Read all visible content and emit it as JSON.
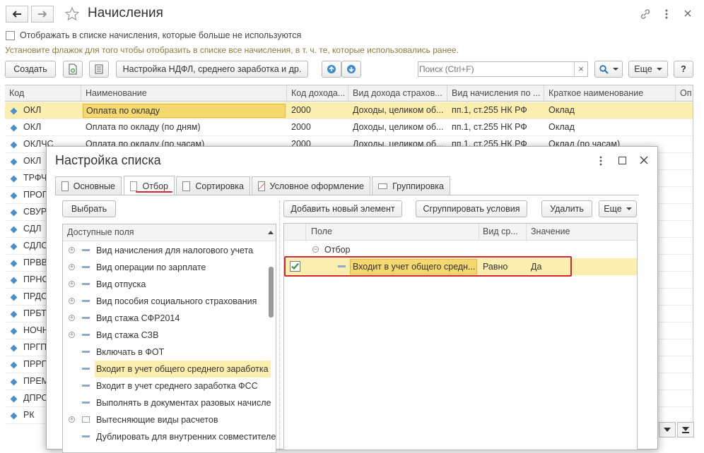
{
  "window": {
    "title": "Начисления",
    "checkbox_label": "Отображать в списке начисления, которые больше не используются",
    "hint": "Установите флажок для того чтобы отобразить в списке все начисления, в т. ч. те, которые использовались ранее."
  },
  "toolbar": {
    "create_label": "Создать",
    "ndfl_label": "Настройка НДФЛ, среднего заработка и др.",
    "search_placeholder": "Поиск (Ctrl+F)",
    "search_clear": "×",
    "more_label": "Еще",
    "help_label": "?"
  },
  "grid": {
    "columns": [
      "Код",
      "Наименование",
      "Код дохода...",
      "Вид дохода страхов...",
      "Вид начисления по ...",
      "Краткое наименование",
      "Оп"
    ],
    "rows": [
      [
        "ОКЛ",
        "Оплата по окладу",
        "2000",
        "Доходы, целиком об...",
        "пп.1, ст.255 НК РФ",
        "Оклад"
      ],
      [
        "ОКЛ",
        "Оплата по окладу (по дням)",
        "2000",
        "Доходы, целиком об...",
        "пп.1, ст.255 НК РФ",
        "Оклад"
      ],
      [
        "ОКЛЧС",
        "Оплата по окладу (по часам)",
        "2000",
        "Доходы, целиком об...",
        "пп.1, ст.255 НК РФ",
        "Оклад (по часам)"
      ],
      [
        "ОКЛ",
        "",
        "",
        "",
        "",
        ""
      ],
      [
        "ТРФЧ",
        "",
        "",
        "",
        "",
        ""
      ],
      [
        "ПРОГ",
        "",
        "",
        "",
        "",
        ""
      ],
      [
        "СВУР",
        "",
        "",
        "",
        "",
        ""
      ],
      [
        "СДЛ",
        "",
        "",
        "",
        "",
        ""
      ],
      [
        "СДЛО",
        "",
        "",
        "",
        "",
        ""
      ],
      [
        "ПРВВ",
        "",
        "",
        "",
        "",
        ""
      ],
      [
        "ПРНО",
        "",
        "",
        "",
        "",
        ""
      ],
      [
        "ПРДО",
        "",
        "",
        "",
        "",
        ""
      ],
      [
        "ПРБТ",
        "",
        "",
        "",
        "",
        ""
      ],
      [
        "НОЧН",
        "",
        "",
        "",
        "",
        ""
      ],
      [
        "ПРГП",
        "",
        "",
        "",
        "",
        ""
      ],
      [
        "ПРРП",
        "",
        "",
        "",
        "",
        ""
      ],
      [
        "ПРЕМ",
        "",
        "",
        "",
        "",
        ""
      ],
      [
        "ДПРО",
        "",
        "",
        "",
        "",
        ""
      ],
      [
        "РК",
        "",
        "",
        "",
        "",
        ""
      ]
    ]
  },
  "dialog": {
    "title": "Настройка списка",
    "tabs": [
      "Основные",
      "Отбор",
      "Сортировка",
      "Условное оформление",
      "Группировка"
    ],
    "select_label": "Выбрать",
    "add_label": "Добавить новый элемент",
    "group_label": "Сгруппировать условия",
    "delete_label": "Удалить",
    "more_label": "Еще",
    "available_fields_header": "Доступные поля",
    "fields": [
      {
        "label": "Вид начисления для налогового учета",
        "expandable": true
      },
      {
        "label": "Вид операции по зарплате",
        "expandable": true
      },
      {
        "label": "Вид отпуска",
        "expandable": true
      },
      {
        "label": "Вид пособия социального страхования",
        "expandable": true
      },
      {
        "label": "Вид стажа  СФР2014",
        "expandable": true
      },
      {
        "label": "Вид стажа СЗВ",
        "expandable": true
      },
      {
        "label": "Включать в ФОТ",
        "expandable": false
      },
      {
        "label": "Входит в учет общего среднего заработка",
        "expandable": false
      },
      {
        "label": "Входит в учет среднего заработка ФСС",
        "expandable": false
      },
      {
        "label": "Выполнять в документах разовых начисле",
        "expandable": false
      },
      {
        "label": "Вытесняющие виды расчетов",
        "expandable": true
      },
      {
        "label": "Дублировать для внутренних совместителе",
        "expandable": false
      }
    ],
    "filter_columns": [
      "Поле",
      "Вид ср...",
      "Значение"
    ],
    "filter_group": "Отбор",
    "filter_row": {
      "field": "Входит в учет общего средн...",
      "comparison": "Равно",
      "value": "Да"
    }
  },
  "colors": {
    "highlight": "#fbeeae",
    "selected_cell_border": "#e0b840",
    "red_frame": "#d9262c",
    "accent_blue": "#4a8fcf"
  }
}
